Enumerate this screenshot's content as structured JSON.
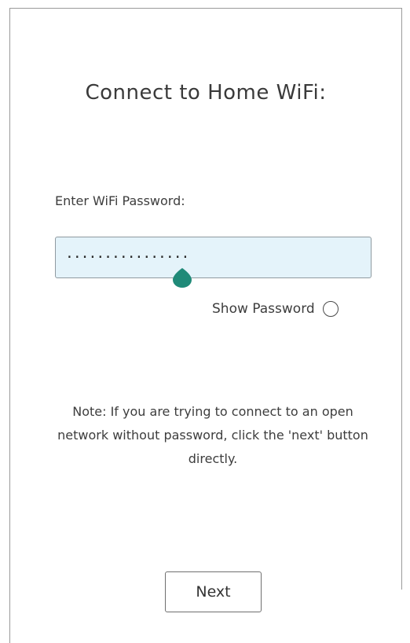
{
  "screen": {
    "title": "Connect to Home WiFi:",
    "password_field": {
      "label": "Enter WiFi Password:",
      "masked_value": "················"
    },
    "show_password": {
      "label": "Show Password",
      "checked": false
    },
    "note": "Note: If you are trying to connect to an open network without password, click the 'next' button directly.",
    "next_button_label": "Next"
  },
  "colors": {
    "input_background": "#e4f3fa",
    "cursor_handle": "#1f8a78",
    "text": "#3d3d3d"
  }
}
